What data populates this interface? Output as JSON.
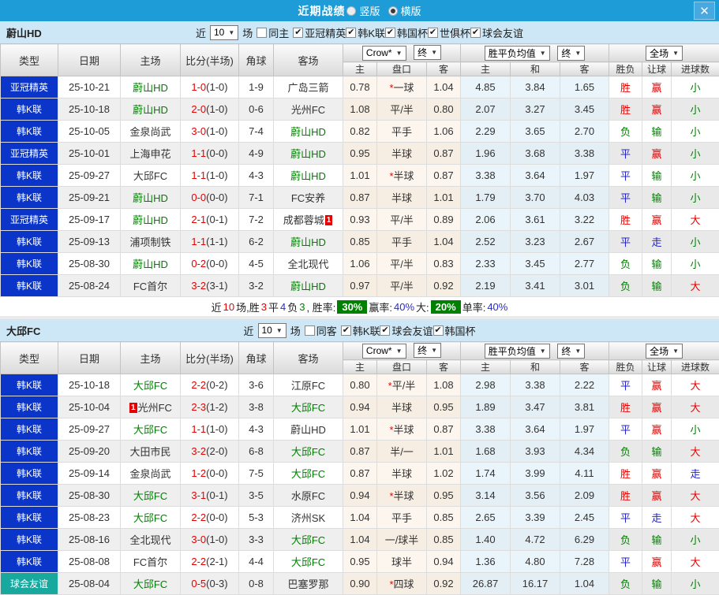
{
  "titlebar": {
    "title": "近期战绩",
    "vertical_label": "竖版",
    "horizontal_label": "横版",
    "selected_layout": "横版"
  },
  "table_header": {
    "base_cols": [
      "类型",
      "日期",
      "主场",
      "比分(半场)",
      "角球",
      "客场"
    ],
    "asian_odds_select": "Crow*",
    "asian_final_select": "终",
    "asian_subcols": [
      "主",
      "盘口",
      "客"
    ],
    "euro_odds_select": "胜平负均值",
    "euro_final_select": "终",
    "euro_subcols": [
      "主",
      "和",
      "客"
    ],
    "scope_select": "全场",
    "result_subcols": [
      "胜负",
      "让球",
      "进球数"
    ]
  },
  "colors": {
    "titlebar_bg": "#1e9cd7",
    "section_header_bg": "#cde7f6",
    "focus_team": "#008000",
    "score_red": "#e60000",
    "badge_bg": "#e60000",
    "type_map": {
      "亚冠精英": "#0a35c8",
      "韩K联": "#0a35c8",
      "球会友谊": "#18a89e"
    },
    "result_map": {
      "胜": "#e60000",
      "平": "#2222cc",
      "负": "#008000",
      "赢": "#e60000",
      "走": "#2222cc",
      "输": "#008000",
      "大": "#e60000",
      "小": "#008000"
    }
  },
  "sections": [
    {
      "team": "蔚山HD",
      "filter": {
        "near": "近",
        "count": "10",
        "unit": "场",
        "same": "同主",
        "same_checked": false,
        "competitions": [
          "亚冠精英",
          "韩K联",
          "韩国杯",
          "世俱杯",
          "球会友谊"
        ]
      },
      "rows": [
        {
          "type": "亚冠精英",
          "date": "25-10-21",
          "home": "蔚山HD",
          "home_focus": true,
          "score": "1-0",
          "half": "(1-0)",
          "corners": "1-9",
          "away": "广岛三箭",
          "asian": [
            "0.78",
            "*一球",
            "1.04"
          ],
          "euro": [
            "4.85",
            "3.84",
            "1.65"
          ],
          "results": [
            "胜",
            "赢",
            "小"
          ]
        },
        {
          "type": "韩K联",
          "date": "25-10-18",
          "home": "蔚山HD",
          "home_focus": true,
          "score": "2-0",
          "half": "(1-0)",
          "corners": "0-6",
          "away": "光州FC",
          "asian": [
            "1.08",
            "平/半",
            "0.80"
          ],
          "euro": [
            "2.07",
            "3.27",
            "3.45"
          ],
          "results": [
            "胜",
            "赢",
            "小"
          ]
        },
        {
          "type": "韩K联",
          "date": "25-10-05",
          "home": "金泉尚武",
          "score": "3-0",
          "half": "(1-0)",
          "corners": "7-4",
          "away": "蔚山HD",
          "away_focus": true,
          "asian": [
            "0.82",
            "平手",
            "1.06"
          ],
          "euro": [
            "2.29",
            "3.65",
            "2.70"
          ],
          "results": [
            "负",
            "输",
            "小"
          ]
        },
        {
          "type": "亚冠精英",
          "date": "25-10-01",
          "home": "上海申花",
          "score": "1-1",
          "half": "(0-0)",
          "corners": "4-9",
          "away": "蔚山HD",
          "away_focus": true,
          "asian": [
            "0.95",
            "半球",
            "0.87"
          ],
          "euro": [
            "1.96",
            "3.68",
            "3.38"
          ],
          "results": [
            "平",
            "赢",
            "小"
          ]
        },
        {
          "type": "韩K联",
          "date": "25-09-27",
          "home": "大邱FC",
          "score": "1-1",
          "half": "(1-0)",
          "corners": "4-3",
          "away": "蔚山HD",
          "away_focus": true,
          "asian": [
            "1.01",
            "*半球",
            "0.87"
          ],
          "euro": [
            "3.38",
            "3.64",
            "1.97"
          ],
          "results": [
            "平",
            "输",
            "小"
          ]
        },
        {
          "type": "韩K联",
          "date": "25-09-21",
          "home": "蔚山HD",
          "home_focus": true,
          "score": "0-0",
          "half": "(0-0)",
          "corners": "7-1",
          "away": "FC安养",
          "asian": [
            "0.87",
            "半球",
            "1.01"
          ],
          "euro": [
            "1.79",
            "3.70",
            "4.03"
          ],
          "results": [
            "平",
            "输",
            "小"
          ]
        },
        {
          "type": "亚冠精英",
          "date": "25-09-17",
          "home": "蔚山HD",
          "home_focus": true,
          "score": "2-1",
          "half": "(0-1)",
          "corners": "7-2",
          "away": "成都蓉城",
          "away_badge": "1",
          "badge_pos": "after",
          "asian": [
            "0.93",
            "平/半",
            "0.89"
          ],
          "euro": [
            "2.06",
            "3.61",
            "3.22"
          ],
          "results": [
            "胜",
            "赢",
            "大"
          ]
        },
        {
          "type": "韩K联",
          "date": "25-09-13",
          "home": "浦项制铁",
          "score": "1-1",
          "half": "(1-1)",
          "corners": "6-2",
          "away": "蔚山HD",
          "away_focus": true,
          "asian": [
            "0.85",
            "平手",
            "1.04"
          ],
          "euro": [
            "2.52",
            "3.23",
            "2.67"
          ],
          "results": [
            "平",
            "走",
            "小"
          ]
        },
        {
          "type": "韩K联",
          "date": "25-08-30",
          "home": "蔚山HD",
          "home_focus": true,
          "score": "0-2",
          "half": "(0-0)",
          "corners": "4-5",
          "away": "全北现代",
          "asian": [
            "1.06",
            "平/半",
            "0.83"
          ],
          "euro": [
            "2.33",
            "3.45",
            "2.77"
          ],
          "results": [
            "负",
            "输",
            "小"
          ]
        },
        {
          "type": "韩K联",
          "date": "25-08-24",
          "home": "FC首尔",
          "score": "3-2",
          "half": "(3-1)",
          "corners": "3-2",
          "away": "蔚山HD",
          "away_focus": true,
          "asian": [
            "0.97",
            "平/半",
            "0.92"
          ],
          "euro": [
            "2.19",
            "3.41",
            "3.01"
          ],
          "results": [
            "负",
            "输",
            "大"
          ]
        }
      ],
      "summary": {
        "segments": [
          {
            "t": "近",
            "c": "k"
          },
          {
            "t": "10",
            "c": "r"
          },
          {
            "t": "场,胜",
            "c": "k"
          },
          {
            "t": "3",
            "c": "r"
          },
          {
            "t": "平",
            "c": "k"
          },
          {
            "t": "4",
            "c": "b"
          },
          {
            "t": "负",
            "c": "k"
          },
          {
            "t": "3",
            "c": "g"
          },
          {
            "t": ", 胜率:",
            "c": "k"
          },
          {
            "t": "30%",
            "c": "badge"
          },
          {
            "t": "赢率:",
            "c": "k"
          },
          {
            "t": "40%",
            "c": "b"
          },
          {
            "t": "大:",
            "c": "k"
          },
          {
            "t": "20%",
            "c": "badge"
          },
          {
            "t": "单率:",
            "c": "k"
          },
          {
            "t": "40%",
            "c": "b"
          }
        ]
      }
    },
    {
      "team": "大邱FC",
      "filter": {
        "near": "近",
        "count": "10",
        "unit": "场",
        "same": "同客",
        "same_checked": false,
        "competitions": [
          "韩K联",
          "球会友谊",
          "韩国杯"
        ]
      },
      "rows": [
        {
          "type": "韩K联",
          "date": "25-10-18",
          "home": "大邱FC",
          "home_focus": true,
          "score": "2-2",
          "half": "(0-2)",
          "corners": "3-6",
          "away": "江原FC",
          "asian": [
            "0.80",
            "*平/半",
            "1.08"
          ],
          "euro": [
            "2.98",
            "3.38",
            "2.22"
          ],
          "results": [
            "平",
            "赢",
            "大"
          ]
        },
        {
          "type": "韩K联",
          "date": "25-10-04",
          "home": "光州FC",
          "home_badge": "1",
          "badge_pos": "before",
          "score": "2-3",
          "half": "(1-2)",
          "corners": "3-8",
          "away": "大邱FC",
          "away_focus": true,
          "asian": [
            "0.94",
            "半球",
            "0.95"
          ],
          "euro": [
            "1.89",
            "3.47",
            "3.81"
          ],
          "results": [
            "胜",
            "赢",
            "大"
          ]
        },
        {
          "type": "韩K联",
          "date": "25-09-27",
          "home": "大邱FC",
          "home_focus": true,
          "score": "1-1",
          "half": "(1-0)",
          "corners": "4-3",
          "away": "蔚山HD",
          "asian": [
            "1.01",
            "*半球",
            "0.87"
          ],
          "euro": [
            "3.38",
            "3.64",
            "1.97"
          ],
          "results": [
            "平",
            "赢",
            "小"
          ]
        },
        {
          "type": "韩K联",
          "date": "25-09-20",
          "home": "大田市民",
          "score": "3-2",
          "half": "(2-0)",
          "corners": "6-8",
          "away": "大邱FC",
          "away_focus": true,
          "asian": [
            "0.87",
            "半/一",
            "1.01"
          ],
          "euro": [
            "1.68",
            "3.93",
            "4.34"
          ],
          "results": [
            "负",
            "输",
            "大"
          ]
        },
        {
          "type": "韩K联",
          "date": "25-09-14",
          "home": "金泉尚武",
          "score": "1-2",
          "half": "(0-0)",
          "corners": "7-5",
          "away": "大邱FC",
          "away_focus": true,
          "asian": [
            "0.87",
            "半球",
            "1.02"
          ],
          "euro": [
            "1.74",
            "3.99",
            "4.11"
          ],
          "results": [
            "胜",
            "赢",
            "走"
          ]
        },
        {
          "type": "韩K联",
          "date": "25-08-30",
          "home": "大邱FC",
          "home_focus": true,
          "score": "3-1",
          "half": "(0-1)",
          "corners": "3-5",
          "away": "水原FC",
          "asian": [
            "0.94",
            "*半球",
            "0.95"
          ],
          "euro": [
            "3.14",
            "3.56",
            "2.09"
          ],
          "results": [
            "胜",
            "赢",
            "大"
          ]
        },
        {
          "type": "韩K联",
          "date": "25-08-23",
          "home": "大邱FC",
          "home_focus": true,
          "score": "2-2",
          "half": "(0-0)",
          "corners": "5-3",
          "away": "济州SK",
          "asian": [
            "1.04",
            "平手",
            "0.85"
          ],
          "euro": [
            "2.65",
            "3.39",
            "2.45"
          ],
          "results": [
            "平",
            "走",
            "大"
          ]
        },
        {
          "type": "韩K联",
          "date": "25-08-16",
          "home": "全北现代",
          "score": "3-0",
          "half": "(1-0)",
          "corners": "3-3",
          "away": "大邱FC",
          "away_focus": true,
          "asian": [
            "1.04",
            "一/球半",
            "0.85"
          ],
          "euro": [
            "1.40",
            "4.72",
            "6.29"
          ],
          "results": [
            "负",
            "输",
            "小"
          ]
        },
        {
          "type": "韩K联",
          "date": "25-08-08",
          "home": "FC首尔",
          "score": "2-2",
          "half": "(2-1)",
          "corners": "4-4",
          "away": "大邱FC",
          "away_focus": true,
          "asian": [
            "0.95",
            "球半",
            "0.94"
          ],
          "euro": [
            "1.36",
            "4.80",
            "7.28"
          ],
          "results": [
            "平",
            "赢",
            "大"
          ]
        },
        {
          "type": "球会友谊",
          "date": "25-08-04",
          "home": "大邱FC",
          "home_focus": true,
          "score": "0-5",
          "half": "(0-3)",
          "corners": "0-8",
          "away": "巴塞罗那",
          "asian": [
            "0.90",
            "*四球",
            "0.92"
          ],
          "euro": [
            "26.87",
            "16.17",
            "1.04"
          ],
          "results": [
            "负",
            "输",
            "小"
          ]
        }
      ]
    }
  ]
}
